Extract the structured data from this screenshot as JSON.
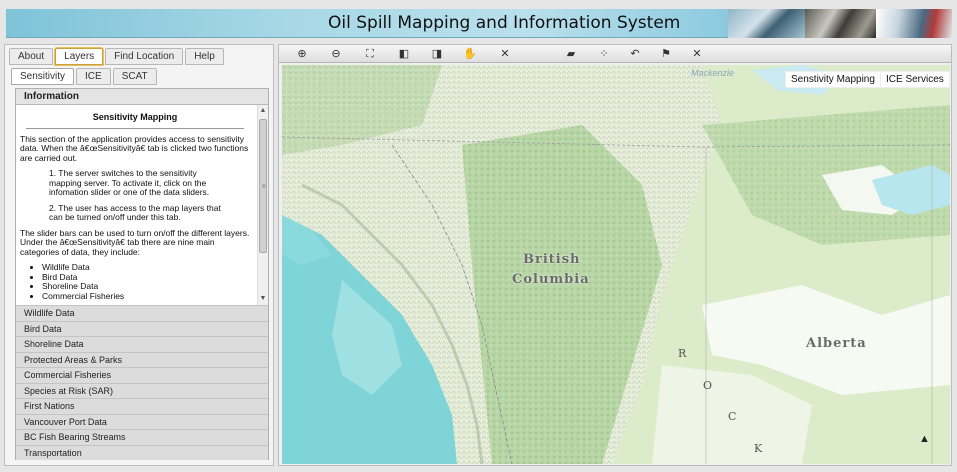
{
  "header": {
    "title": "Oil Spill Mapping and Information System"
  },
  "main_tabs": [
    {
      "label": "About",
      "active": false
    },
    {
      "label": "Layers",
      "active": true
    },
    {
      "label": "Find Location",
      "active": false
    },
    {
      "label": "Help",
      "active": false
    }
  ],
  "sub_tabs": [
    {
      "label": "Sensitivity",
      "active": true
    },
    {
      "label": "ICE",
      "active": false
    },
    {
      "label": "SCAT",
      "active": false
    }
  ],
  "info": {
    "header": "Information",
    "heading": "Sensitivity Mapping",
    "para1": "This section of the application provides access to sensitivity data. When the â€œSensitivityâ€ tab is clicked two functions are carried out.",
    "step1": "1. The server switches to the sensitivity mapping server. To activate it, click on the infomation slider or one of the data sliders.",
    "step2": "2. The user has access to the map layers that can be turned on/off under this tab.",
    "para2": "The slider bars can be used to turn on/off the different layers. Under the â€œSensitivityâ€ tab there are nine main categories of data, they include:",
    "list": [
      "Wildlife Data",
      "Bird Data",
      "Shoreline Data",
      "Commercial Fisheries"
    ]
  },
  "sliders": [
    "Wildlife Data",
    "Bird Data",
    "Shoreline Data",
    "Protected Areas & Parks",
    "Commercial Fisheries",
    "Species at Risk (SAR)",
    "First Nations",
    "Vancouver Port Data",
    "BC Fish Bearing Streams",
    "Transportation"
  ],
  "toolbar": {
    "tools": [
      {
        "name": "zoom-in-icon",
        "glyph": "⊕"
      },
      {
        "name": "zoom-out-icon",
        "glyph": "⊖"
      },
      {
        "name": "full-extent-icon",
        "glyph": "⛶"
      },
      {
        "name": "zoom-previous-icon",
        "glyph": "◧"
      },
      {
        "name": "zoom-next-icon",
        "glyph": "◨"
      },
      {
        "name": "pan-icon",
        "glyph": "✋"
      },
      {
        "name": "clear-icon",
        "glyph": "✕"
      },
      {
        "name": "print-icon",
        "glyph": "▰"
      },
      {
        "name": "measure-icon",
        "glyph": "⁘"
      },
      {
        "name": "draw-icon",
        "glyph": "↶"
      },
      {
        "name": "identify-icon",
        "glyph": "⚑"
      },
      {
        "name": "clear-graphics-icon",
        "glyph": "✕"
      }
    ]
  },
  "map": {
    "buttons": {
      "sensitivity": "Senstivity Mapping",
      "ice": "ICE Services"
    },
    "labels": {
      "bc_line1": "British",
      "bc_line2": "Columbia",
      "alberta": "Alberta",
      "mackenzie": "Mackenzie",
      "rocky": [
        "R",
        "O",
        "C",
        "K"
      ]
    },
    "north_arrow": "▲"
  },
  "colors": {
    "ocean": "#7fd4d8",
    "land": "#d8e9c4",
    "forest": "#a9cc97",
    "snow": "#ffffff",
    "lake": "#b8e6ef"
  }
}
